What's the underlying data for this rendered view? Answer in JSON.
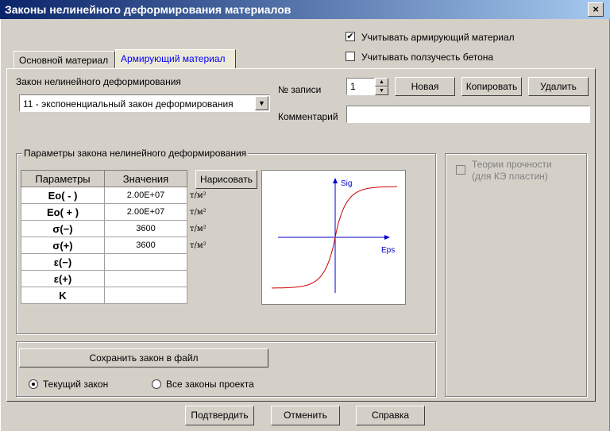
{
  "window": {
    "title": "Законы нелинейного деформирования материалов",
    "close_label": "×"
  },
  "options": {
    "use_reinforcing": {
      "label": "Учитывать армирующий материал",
      "checked": true
    },
    "use_creep": {
      "label": "Учитывать ползучесть бетона",
      "checked": false
    }
  },
  "tabs": [
    {
      "label": "Основной материал",
      "active": false
    },
    {
      "label": "Армирующий материал",
      "active": true
    }
  ],
  "law": {
    "label": "Закон нелинейного деформирования",
    "selected": "11 - экспоненциальный закон деформирования"
  },
  "record": {
    "label": "№ записи",
    "value": "1",
    "new_label": "Новая",
    "copy_label": "Копировать",
    "delete_label": "Удалить",
    "comment_label": "Комментарий",
    "comment_value": ""
  },
  "params": {
    "group_title": "Параметры закона нелинейного деформирования",
    "col_params": "Параметры",
    "col_values": "Значения",
    "draw_label": "Нарисовать",
    "rows": [
      {
        "name": "Eo( - )",
        "value": "2.00E+07",
        "unit": "т/м²"
      },
      {
        "name": "Eo( + )",
        "value": "2.00E+07",
        "unit": "т/м²"
      },
      {
        "name": "σ(−)",
        "value": "3600",
        "unit": "т/м²"
      },
      {
        "name": "σ(+)",
        "value": "3600",
        "unit": "т/м²"
      },
      {
        "name": "ε(−)",
        "value": "",
        "unit": ""
      },
      {
        "name": "ε(+)",
        "value": "",
        "unit": ""
      },
      {
        "name": "K",
        "value": "",
        "unit": ""
      }
    ]
  },
  "plot": {
    "y_label": "Sig",
    "x_label": "Eps",
    "axis_color": "#0000cc",
    "curve_color": "#cc0000"
  },
  "strength": {
    "label_line1": "Теории прочности",
    "label_line2": "(для КЭ пластин)",
    "checked": false
  },
  "save": {
    "button_label": "Сохранить закон в файл",
    "current_label": "Текущий закон",
    "all_label": "Все законы проекта",
    "selected": "current"
  },
  "footer": {
    "confirm_label": "Подтвердить",
    "cancel_label": "Отменить",
    "help_label": "Справка"
  }
}
